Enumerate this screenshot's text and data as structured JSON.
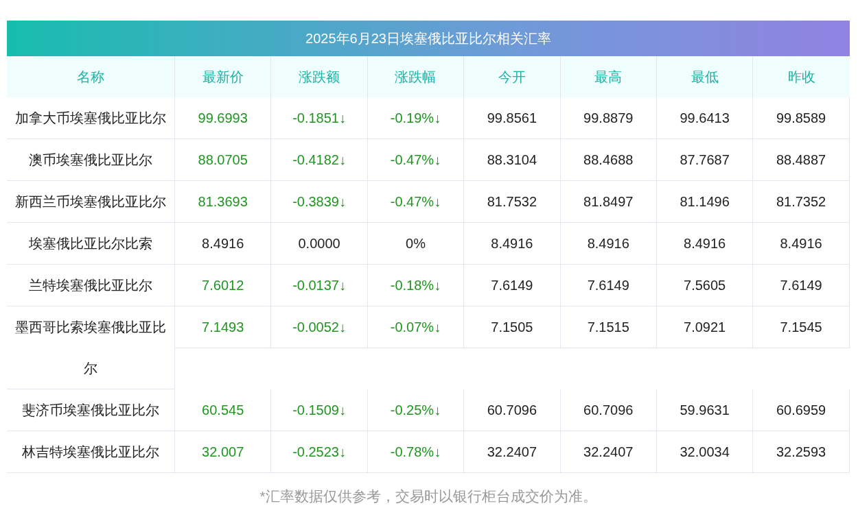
{
  "title": "2025年6月23日埃塞俄比亚比尔相关汇率",
  "columns": [
    "名称",
    "最新价",
    "涨跌额",
    "涨跌幅",
    "今开",
    "最高",
    "最低",
    "昨收"
  ],
  "rows": [
    {
      "down": true,
      "cells": [
        "加拿大币埃塞俄比亚比尔",
        "99.6993",
        "-0.1851↓",
        "-0.19%↓",
        "99.8561",
        "99.8879",
        "99.6413",
        "99.8589"
      ]
    },
    {
      "down": true,
      "cells": [
        "澳币埃塞俄比亚比尔",
        "88.0705",
        "-0.4182↓",
        "-0.47%↓",
        "88.3104",
        "88.4688",
        "87.7687",
        "88.4887"
      ]
    },
    {
      "down": true,
      "cells": [
        "新西兰币埃塞俄比亚比尔",
        "81.3693",
        "-0.3839↓",
        "-0.47%↓",
        "81.7532",
        "81.8497",
        "81.1496",
        "81.7352"
      ]
    },
    {
      "down": false,
      "cells": [
        "埃塞俄比亚比尔比索",
        "8.4916",
        "0.0000",
        "0%",
        "8.4916",
        "8.4916",
        "8.4916",
        "8.4916"
      ]
    },
    {
      "down": true,
      "cells": [
        "兰特埃塞俄比亚比尔",
        "7.6012",
        "-0.0137↓",
        "-0.18%↓",
        "7.6149",
        "7.6149",
        "7.5605",
        "7.6149"
      ]
    },
    {
      "down": true,
      "cells": [
        "墨西哥比索埃塞俄比亚比尔",
        "7.1493",
        "-0.0052↓",
        "-0.07%↓",
        "7.1505",
        "7.1515",
        "7.0921",
        "7.1545"
      ]
    },
    {
      "down": true,
      "cells": [
        "斐济币埃塞俄比亚比尔",
        "60.545",
        "-0.1509↓",
        "-0.25%↓",
        "60.7096",
        "60.7096",
        "59.9631",
        "60.6959"
      ]
    },
    {
      "down": true,
      "cells": [
        "林吉特埃塞俄比亚比尔",
        "32.007",
        "-0.2523↓",
        "-0.78%↓",
        "32.2407",
        "32.2407",
        "32.0034",
        "32.2593"
      ]
    }
  ],
  "footnote": "*汇率数据仅供参考，交易时以银行柜台成交价为准。"
}
